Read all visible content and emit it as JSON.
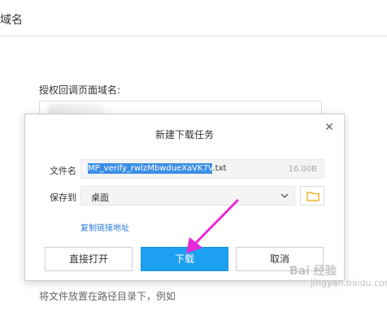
{
  "background": {
    "header_title": "域名",
    "field_label": "授权回调页面域名:",
    "hint": "将文件放置在路径目录下，例如"
  },
  "dialog": {
    "title": "新建下载任务",
    "close_icon": "close-icon",
    "file_label": "文件名",
    "file_name_selected": "MP_verify_rwlzMbwdueXaVK7V",
    "file_name_ext": ".txt",
    "file_size": "16.00B",
    "save_label": "保存到",
    "save_location": "桌面",
    "copy_link": "复制链接地址",
    "buttons": {
      "open": "直接打开",
      "download": "下载",
      "cancel": "取消"
    }
  },
  "colors": {
    "accent": "#1ea0f0",
    "selection": "#3d8fe6",
    "link": "#2a7ad5",
    "annotation_arrow": "#e62ad6",
    "folder_icon": "#f0a30a"
  },
  "watermark": {
    "text": "Bai 经验",
    "sub": "jingyan.baidu.com"
  }
}
